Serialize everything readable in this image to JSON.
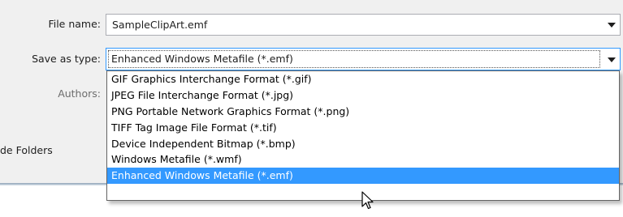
{
  "labels": {
    "file_name": "File name:",
    "save_as_type": "Save as type:",
    "authors": "Authors:",
    "folders": "de Folders"
  },
  "file_name_value": "SampleClipArt.emf",
  "save_as_type_value": "Enhanced Windows Metafile (*.emf)",
  "type_options": [
    "GIF Graphics Interchange Format (*.gif)",
    "JPEG File Interchange Format (*.jpg)",
    "PNG Portable Network Graphics Format (*.png)",
    "TIFF Tag Image File Format (*.tif)",
    "Device Independent Bitmap (*.bmp)",
    "Windows Metafile (*.wmf)",
    "Enhanced Windows Metafile (*.emf)"
  ],
  "selected_option_index": 6,
  "colors": {
    "selection": "#3399ff",
    "background": "#f0f0f0"
  },
  "icons": {
    "dropdown_arrow": "chevron-down-icon",
    "cursor": "mouse-pointer-icon"
  }
}
